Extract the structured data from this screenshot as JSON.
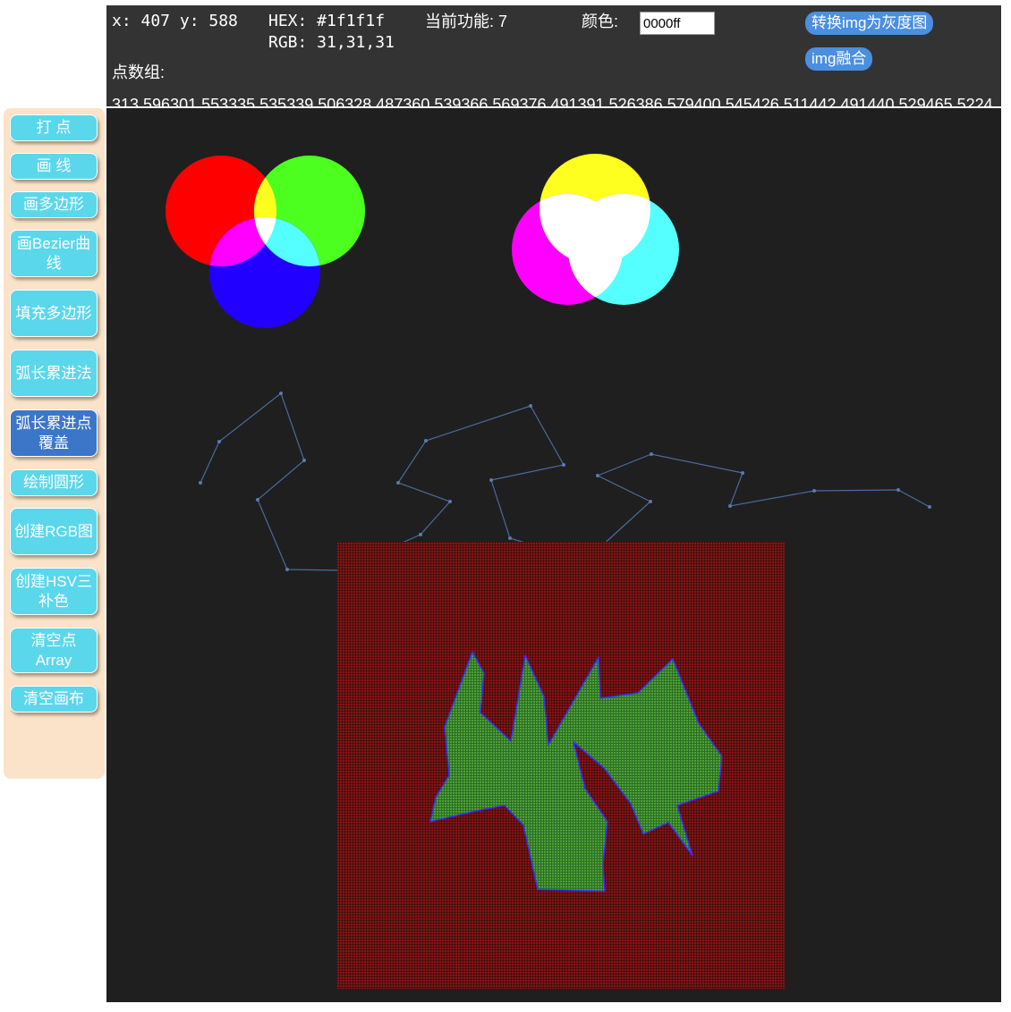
{
  "status": {
    "coord": "x: 407 y: 588",
    "hex": "HEX: #1f1f1f",
    "rgb": "RGB: 31,31,31",
    "function": "当前功能: 7",
    "color_label": "颜色:",
    "color_value": "0000ff",
    "points_label": "点数组:",
    "points_array": "313 596301 553335 535339 506328 487360 539366 569376 491391 526386 579400 545426 511442 491440 529465 5224"
  },
  "top_buttons": {
    "gray": "转换img为灰度图",
    "blend": "img融合"
  },
  "sidebar": [
    {
      "label": "打 点"
    },
    {
      "label": "画 线"
    },
    {
      "label": "画多边形"
    },
    {
      "label": "画Bezier曲线"
    },
    {
      "label": "填充多边形"
    },
    {
      "label": "弧长累进法"
    },
    {
      "label": "弧长累进点覆盖"
    },
    {
      "label": "绘制圆形"
    },
    {
      "label": "创建RGB图"
    },
    {
      "label": "创建HSV三补色"
    },
    {
      "label": "清空点Array"
    },
    {
      "label": "清空画布"
    }
  ],
  "colors": {
    "canvas_bg": "#1f1f1f",
    "topbar_bg": "#333333",
    "sidebar_bg": "#fae3c8",
    "button": "#5bd7ec",
    "button_active": "#3c76c9",
    "red": "#ff0000",
    "green": "#4cff1f",
    "blue": "#2200ff",
    "yellow": "#ffff1f",
    "magenta": "#ff00ff",
    "cyan": "#55ffff",
    "polyline": "#4a6a9a",
    "fill_red": "#7a1010",
    "fill_green": "#3f8a2c",
    "outline": "#3030ff"
  }
}
